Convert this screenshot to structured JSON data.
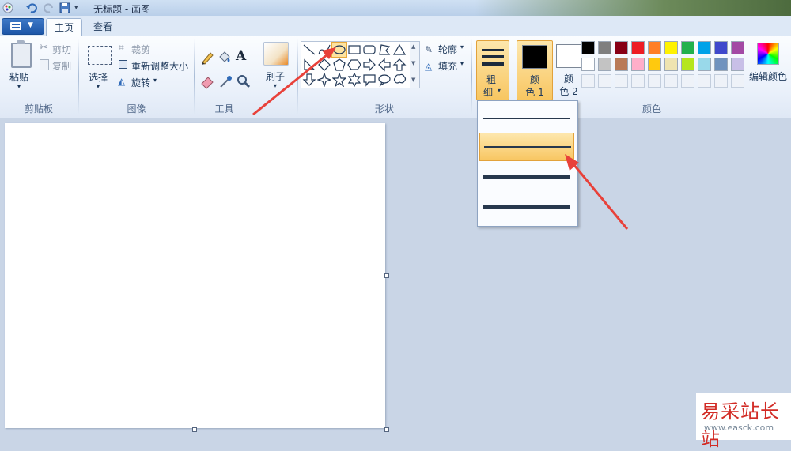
{
  "window": {
    "title": "无标题 - 画图"
  },
  "tabs": [
    {
      "label": "主页",
      "active": true
    },
    {
      "label": "查看",
      "active": false
    }
  ],
  "groups": {
    "clipboard": {
      "label": "剪贴板",
      "paste": "粘贴",
      "cut": "剪切",
      "copy": "复制"
    },
    "image": {
      "label": "图像",
      "select": "选择",
      "crop": "裁剪",
      "resize": "重新调整大小",
      "rotate": "旋转"
    },
    "tools": {
      "label": "工具"
    },
    "brushes": {
      "label": "刷子"
    },
    "shapes": {
      "label": "形状",
      "outline": "轮廓",
      "fill": "填充"
    },
    "size": {
      "label_top": "粗",
      "label_bottom": "细"
    },
    "colors": {
      "label": "颜色",
      "color1_top": "颜",
      "color1_bottom": "色 1",
      "color2_top": "颜",
      "color2_bottom": "色 2",
      "edit": "编辑颜色",
      "color1_value": "#000000",
      "color2_value": "#ffffff",
      "palette_row1": [
        "#000000",
        "#7f7f7f",
        "#880015",
        "#ed1c24",
        "#ff7f27",
        "#fff200",
        "#22b14c",
        "#00a2e8",
        "#3f48cc",
        "#a349a4"
      ],
      "palette_row2": [
        "#ffffff",
        "#c3c3c3",
        "#b97a57",
        "#ffaec9",
        "#ffc90e",
        "#efe4b0",
        "#b5e61d",
        "#99d9ea",
        "#7092be",
        "#c8bfe7"
      ]
    }
  },
  "size_menu": {
    "options": [
      1,
      3,
      5,
      8
    ],
    "selected_index": 1
  },
  "accent": {
    "highlight": "#f8c661",
    "annotation_arrow": "#e8413a"
  },
  "watermark": {
    "cn": "易采站长站",
    "url": "www.easck.com"
  }
}
